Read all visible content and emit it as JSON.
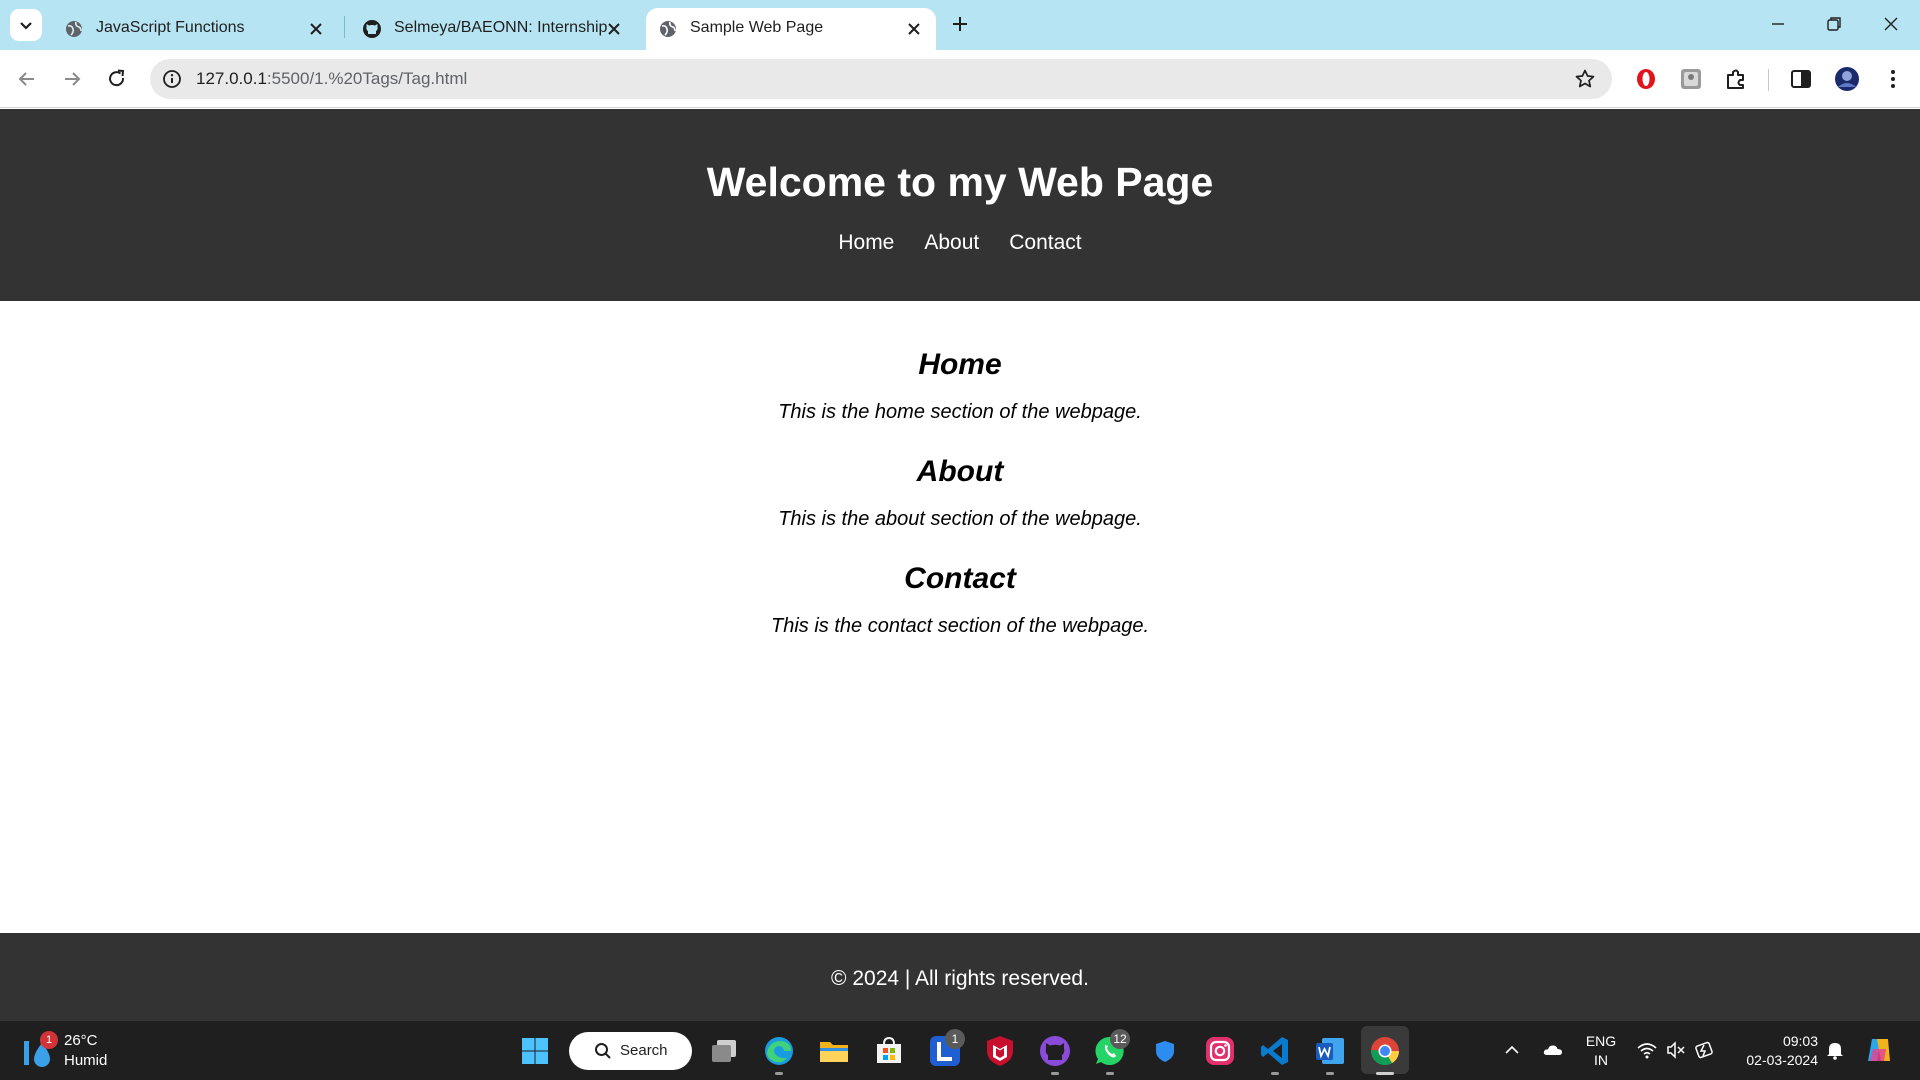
{
  "browser": {
    "tabs": [
      {
        "title": "JavaScript Functions",
        "active": false,
        "icon": "globe-icon"
      },
      {
        "title": "Selmeya/BAEONN: Internship",
        "active": false,
        "icon": "github-icon"
      },
      {
        "title": "Sample Web Page",
        "active": true,
        "icon": "globe-icon"
      }
    ],
    "url_host": "127.0.0.1",
    "url_path": ":5500/1.%20Tags/Tag.html",
    "accent": "#b7e4f2"
  },
  "page": {
    "title": "Welcome to my Web Page",
    "nav": [
      "Home",
      "About",
      "Contact"
    ],
    "sections": [
      {
        "heading": "Home",
        "text": "This is the home section of the webpage."
      },
      {
        "heading": "About",
        "text": "This is the about section of the webpage."
      },
      {
        "heading": "Contact",
        "text": "This is the contact section of the webpage."
      }
    ],
    "footer": "© 2024 | All rights reserved.",
    "header_color": "#333333"
  },
  "taskbar": {
    "weather_badge": "1",
    "temperature": "26°C",
    "condition": "Humid",
    "search_label": "Search",
    "badge_tasks": "1",
    "badge_whatsapp": "12",
    "language": "ENG",
    "region": "IN",
    "time": "09:03",
    "date": "02-03-2024"
  }
}
